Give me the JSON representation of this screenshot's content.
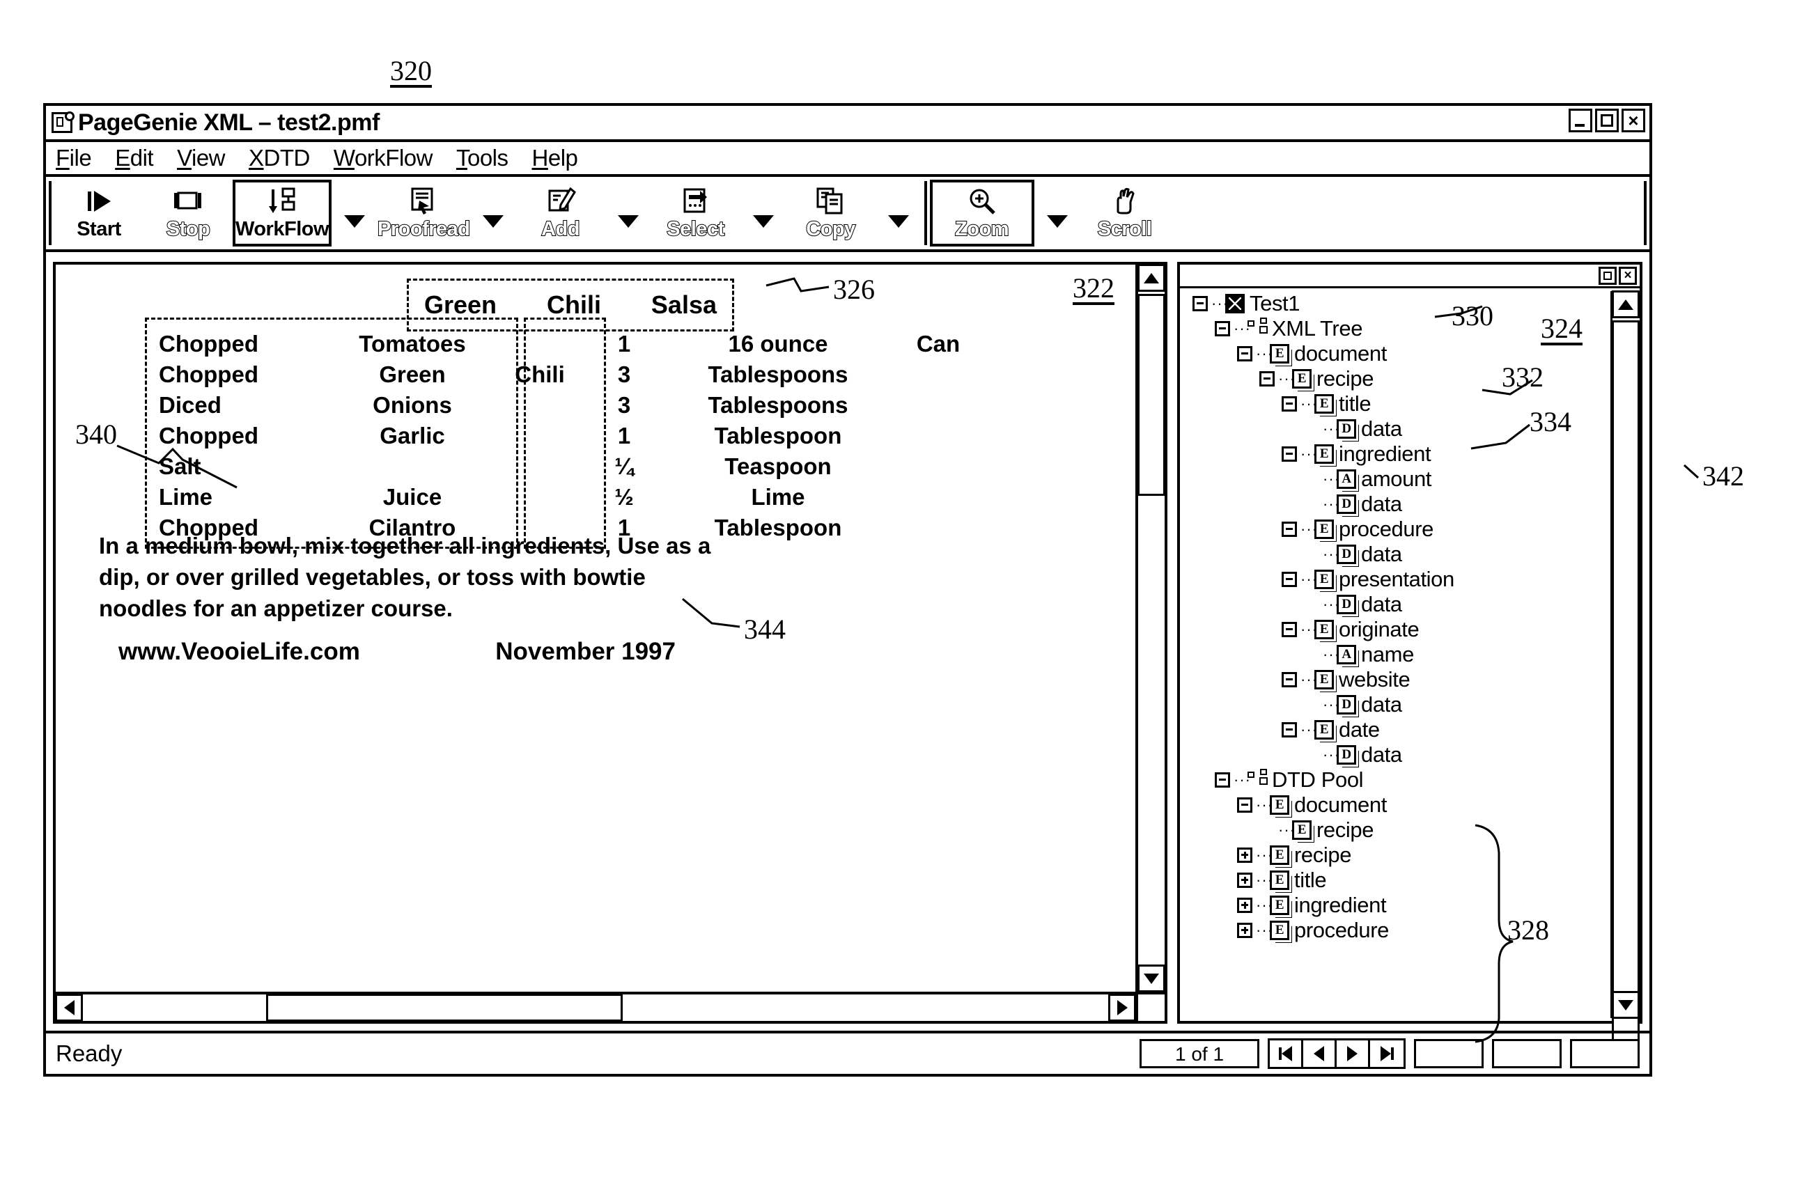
{
  "figure": {
    "main_ref": "320",
    "doc_pane_ref": "322",
    "tree_pane_ref": "324",
    "title_box_ref": "326",
    "dtd_pool_ref": "328",
    "xml_tree_ref": "330",
    "recipe_ref": "332",
    "title_node_ref": "334",
    "ingredient_box_ref": "340",
    "right_edge_ref": "342",
    "quantity_box_ref": "344"
  },
  "window": {
    "title": "PageGenie XML – test2.pmf",
    "icon": "app-icon",
    "buttons": {
      "minimize": "_",
      "maximize": "□",
      "close": "×"
    }
  },
  "menu": {
    "items": [
      {
        "pre": "",
        "accel": "F",
        "post": "ile"
      },
      {
        "pre": "",
        "accel": "E",
        "post": "dit"
      },
      {
        "pre": "",
        "accel": "V",
        "post": "iew"
      },
      {
        "pre": "",
        "accel": "X",
        "post": "DTD"
      },
      {
        "pre": "",
        "accel": "W",
        "post": "orkFlow"
      },
      {
        "pre": "",
        "accel": "T",
        "post": "ools"
      },
      {
        "pre": "",
        "accel": "H",
        "post": "elp"
      }
    ]
  },
  "toolbar": {
    "buttons": [
      {
        "label": "Start",
        "icon": "play-icon",
        "enabled": true,
        "boxed": false,
        "caret": false
      },
      {
        "label": "Stop",
        "icon": "stop-icon",
        "enabled": false,
        "boxed": false,
        "caret": false
      },
      {
        "label": "WorkFlow",
        "icon": "workflow-icon",
        "enabled": true,
        "boxed": true,
        "caret": true
      },
      {
        "label": "Proofread",
        "icon": "proofread-icon",
        "enabled": false,
        "boxed": false,
        "caret": true
      },
      {
        "label": "Add",
        "icon": "add-icon",
        "enabled": false,
        "boxed": false,
        "caret": true
      },
      {
        "label": "Select",
        "icon": "select-icon",
        "enabled": false,
        "boxed": false,
        "caret": true
      },
      {
        "label": "Copy",
        "icon": "copy-icon",
        "enabled": false,
        "boxed": false,
        "caret": true
      },
      {
        "label": "Zoom",
        "icon": "zoom-icon",
        "enabled": false,
        "boxed": true,
        "caret": true
      },
      {
        "label": "Scroll",
        "icon": "hand-icon",
        "enabled": false,
        "boxed": false,
        "caret": false
      }
    ]
  },
  "document": {
    "title_words": [
      "Green",
      "Chili",
      "Salsa"
    ],
    "ingredients": [
      {
        "prep": "Chopped",
        "name": "Tomatoes",
        "name2": "",
        "qty": "1",
        "unit": "16 ounce",
        "unit2": "Can"
      },
      {
        "prep": "Chopped",
        "name": "Green",
        "name2": "Chili",
        "qty": "3",
        "unit": "Tablespoons",
        "unit2": ""
      },
      {
        "prep": "Diced",
        "name": "Onions",
        "name2": "",
        "qty": "3",
        "unit": "Tablespoons",
        "unit2": ""
      },
      {
        "prep": "Chopped",
        "name": "Garlic",
        "name2": "",
        "qty": "1",
        "unit": "Tablespoon",
        "unit2": ""
      },
      {
        "prep": "Salt",
        "name": "",
        "name2": "",
        "qty": "¼",
        "unit": "Teaspoon",
        "unit2": ""
      },
      {
        "prep": "Lime",
        "name": "Juice",
        "name2": "",
        "qty": "½",
        "unit": "Lime",
        "unit2": ""
      },
      {
        "prep": "Chopped",
        "name": "Cilantro",
        "name2": "",
        "qty": "1",
        "unit": "Tablespoon",
        "unit2": ""
      }
    ],
    "paragraph": "In a medium bowl, mix together all ingredients,    Use as a dip, or over grilled vegetables, or toss with bowtie noodles for an appetizer   course.",
    "website": "www.VeooieLife.com",
    "date": "November 1997"
  },
  "tree": {
    "rows": [
      {
        "indent": 0,
        "toggle": "minus",
        "icon": "root-icon",
        "label": "Test1"
      },
      {
        "indent": 1,
        "toggle": "minus",
        "icon": "hierarchy-icon",
        "label": "XML Tree"
      },
      {
        "indent": 2,
        "toggle": "minus",
        "icon": "element-icon",
        "label": "document"
      },
      {
        "indent": 3,
        "toggle": "minus",
        "icon": "element-icon",
        "label": "recipe"
      },
      {
        "indent": 4,
        "toggle": "minus",
        "icon": "element-icon",
        "label": "title"
      },
      {
        "indent": 5,
        "toggle": "none",
        "icon": "data-icon",
        "label": "data"
      },
      {
        "indent": 4,
        "toggle": "minus",
        "icon": "element-icon",
        "label": "ingredient"
      },
      {
        "indent": 5,
        "toggle": "none",
        "icon": "attribute-icon",
        "label": "amount"
      },
      {
        "indent": 5,
        "toggle": "none",
        "icon": "data-icon",
        "label": "data"
      },
      {
        "indent": 4,
        "toggle": "minus",
        "icon": "element-icon",
        "label": "procedure"
      },
      {
        "indent": 5,
        "toggle": "none",
        "icon": "data-icon",
        "label": "data"
      },
      {
        "indent": 4,
        "toggle": "minus",
        "icon": "element-icon",
        "label": "presentation"
      },
      {
        "indent": 5,
        "toggle": "none",
        "icon": "data-icon",
        "label": "data"
      },
      {
        "indent": 4,
        "toggle": "minus",
        "icon": "element-icon",
        "label": "originate"
      },
      {
        "indent": 5,
        "toggle": "none",
        "icon": "attribute-icon",
        "label": "name"
      },
      {
        "indent": 4,
        "toggle": "minus",
        "icon": "element-icon",
        "label": "website"
      },
      {
        "indent": 5,
        "toggle": "none",
        "icon": "data-icon",
        "label": "data"
      },
      {
        "indent": 4,
        "toggle": "minus",
        "icon": "element-icon",
        "label": "date"
      },
      {
        "indent": 5,
        "toggle": "none",
        "icon": "data-icon",
        "label": "data"
      },
      {
        "indent": 1,
        "toggle": "minus",
        "icon": "hierarchy-icon",
        "label": "DTD Pool"
      },
      {
        "indent": 2,
        "toggle": "minus",
        "icon": "element-icon",
        "label": "document"
      },
      {
        "indent": 3,
        "toggle": "none",
        "icon": "element-icon",
        "label": "recipe"
      },
      {
        "indent": 2,
        "toggle": "plus",
        "icon": "element-icon",
        "label": "recipe"
      },
      {
        "indent": 2,
        "toggle": "plus",
        "icon": "element-icon",
        "label": "title"
      },
      {
        "indent": 2,
        "toggle": "plus",
        "icon": "element-icon",
        "label": "ingredient"
      },
      {
        "indent": 2,
        "toggle": "plus",
        "icon": "element-icon",
        "label": "procedure"
      }
    ]
  },
  "statusbar": {
    "message": "Ready",
    "page_indicator": "1 of 1",
    "nav": [
      "first-page",
      "previous-page",
      "next-page",
      "last-page"
    ]
  }
}
